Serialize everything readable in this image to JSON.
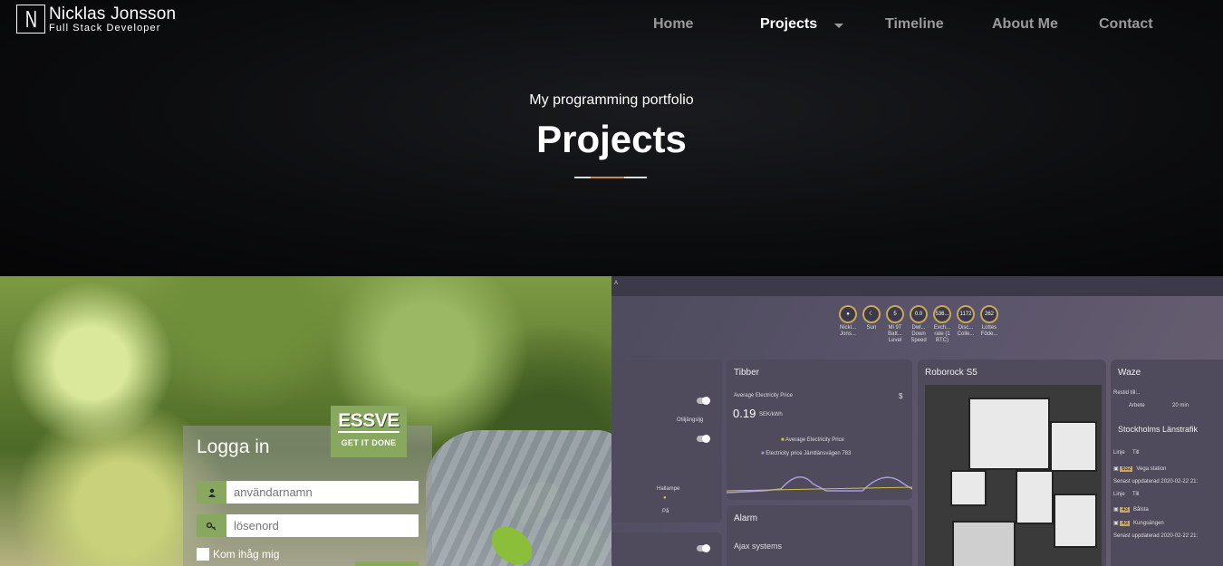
{
  "header": {
    "logo_letter": "N",
    "logo_name": "Nicklas Jonsson",
    "logo_subtitle": "Full Stack Developer"
  },
  "nav": {
    "home": "Home",
    "projects": "Projects",
    "timeline": "Timeline",
    "about": "About Me",
    "contact": "Contact"
  },
  "hero": {
    "subtitle": "My programming portfolio",
    "title": "Projects"
  },
  "project_left": {
    "login_title": "Logga in",
    "brand_name": "ESSVE",
    "brand_tagline": "GET IT DONE",
    "username_placeholder": "användarnamn",
    "password_placeholder": "lösenord",
    "remember_label": "Kom ihåg mig"
  },
  "project_right": {
    "topbar_text": "A",
    "badges": [
      {
        "value": "",
        "label": "Nickl... Jons..."
      },
      {
        "value": "",
        "label": "Sun"
      },
      {
        "value": "5",
        "label": "Mi 9T Batt... Level"
      },
      {
        "value": "0.0",
        "label": "Dwl... Down Speed"
      },
      {
        "value": "536...",
        "label": "Exch... rate (1 BTC)"
      },
      {
        "value": "1172",
        "label": "Disc... Colle..."
      },
      {
        "value": "262",
        "label": "Lottes Föde..."
      }
    ],
    "left_card": {
      "label1": "Otiljängsljg",
      "label2": "Hallampe",
      "label3": "På"
    },
    "tibber": {
      "title": "Tibber",
      "metric_label": "Average Electricity Price",
      "currency": "$",
      "value": "0.19",
      "unit": "SEK/kWh",
      "legend1": "Average Electricity Price",
      "legend2": "Electricity price Jämtlänsvägen 783"
    },
    "alarm": {
      "title": "Alarm",
      "subtitle": "Ajax systems"
    },
    "roborock": {
      "title": "Roborock S5"
    },
    "waze": {
      "title": "Waze",
      "row_label": "Restid till...",
      "dest": "Arbete",
      "time": "20 min",
      "sl_title": "Stockholms Länstrafik",
      "col1": "Linje",
      "col2": "Till",
      "route1_line": "632",
      "route1_dest": "Vega station",
      "updated1": "Senast uppdaterad 2020-02-22 21:",
      "route2_line": "43",
      "route2_dest": "Bålsta",
      "route3_line": "43",
      "route3_dest": "Kungsängen",
      "updated2": "Senast uppdaterad 2020-02-22 21:"
    }
  }
}
